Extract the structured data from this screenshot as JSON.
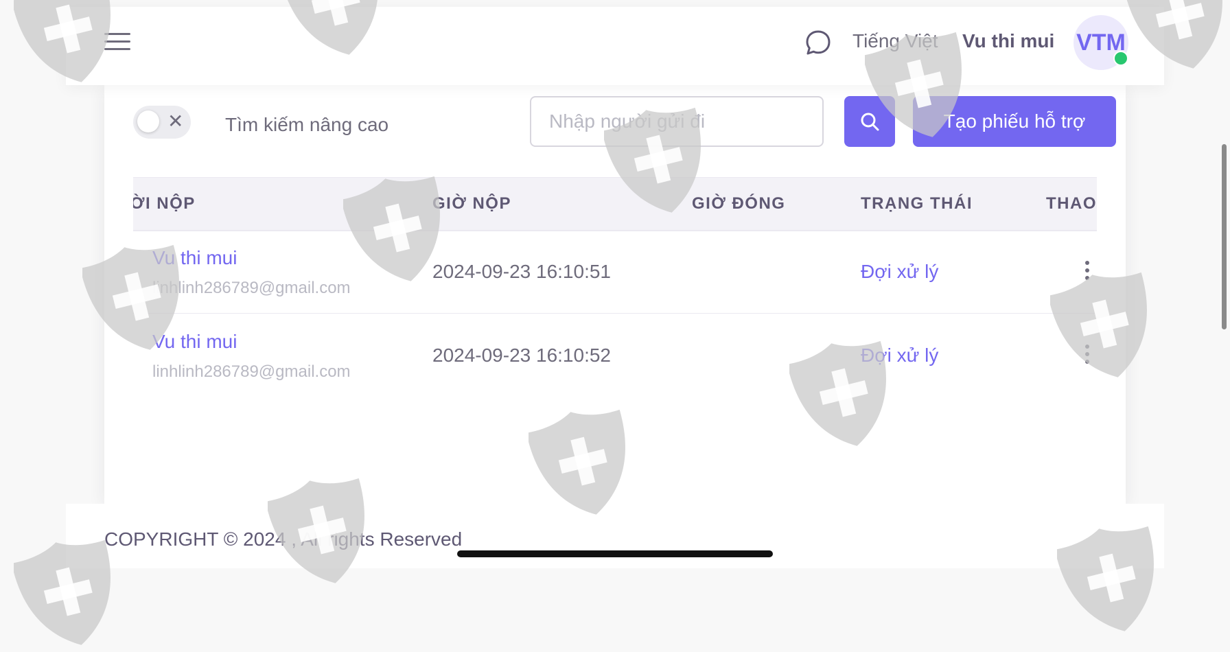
{
  "header": {
    "menu_icon": "hamburger-menu-icon",
    "chat_icon": "chat-bubble-icon",
    "language": "Tiếng Việt",
    "user_name": "Vu thi mui",
    "avatar_initials": "VTM",
    "online_status_color": "#28c76f"
  },
  "toolbar": {
    "advanced_search_toggle_icon": "close-x-icon",
    "advanced_search_label": "Tìm kiếm nâng cao",
    "search_placeholder": "Nhập người gửi đi",
    "search_icon": "search-icon",
    "create_button_label": "Tạo phiếu hỗ trợ"
  },
  "table": {
    "columns": [
      "ỜI NỘP",
      "GIỜ NỘP",
      "GIỜ ĐÓNG",
      "TRẠNG THÁI",
      "THAO"
    ],
    "rows": [
      {
        "sender_name": "Vu thi mui",
        "sender_email": "linhlinh286789@gmail.com",
        "submit_time": "2024-09-23 16:10:51",
        "close_time": "",
        "status": "Đợi xử lý",
        "actions_icon": "more-vertical-icon"
      },
      {
        "sender_name": "Vu thi mui",
        "sender_email": "linhlinh286789@gmail.com",
        "submit_time": "2024-09-23 16:10:52",
        "close_time": "",
        "status": "Đợi xử lý",
        "actions_icon": "more-vertical-icon"
      }
    ]
  },
  "footer": {
    "copyright": "COPYRIGHT © 2024 , All rights Reserved"
  },
  "colors": {
    "primary": "#7367f0",
    "text": "#5e5873",
    "muted": "#b9b9c3",
    "watermark": "#c8c8c8"
  },
  "watermark_icon": "shield-cross-icon"
}
